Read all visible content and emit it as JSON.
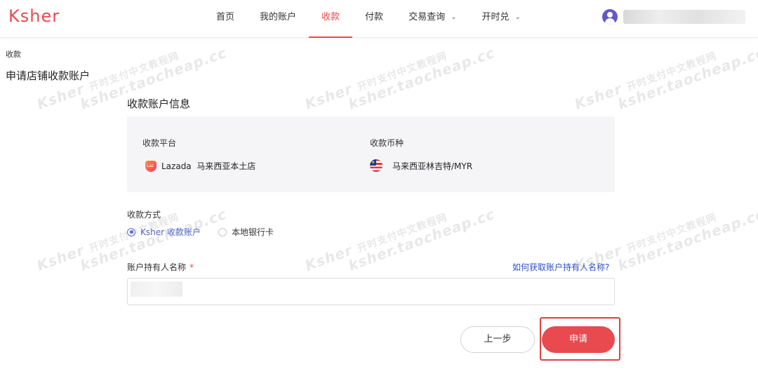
{
  "header": {
    "logo": "Ksher",
    "nav": [
      {
        "label": "首页",
        "active": false,
        "dropdown": false
      },
      {
        "label": "我的账户",
        "active": false,
        "dropdown": false
      },
      {
        "label": "收款",
        "active": true,
        "dropdown": false
      },
      {
        "label": "付款",
        "active": false,
        "dropdown": false
      },
      {
        "label": "交易查询",
        "active": false,
        "dropdown": true
      },
      {
        "label": "开时兑",
        "active": false,
        "dropdown": true
      }
    ],
    "avatar_icon": "user-icon"
  },
  "breadcrumb": "收款",
  "page_title": "申请店铺收款账户",
  "section_title": "收款账户信息",
  "account_info": {
    "platform_label": "收款平台",
    "platform_icon": "lazada-icon",
    "platform_value": "Lazada  马来西亚本土店",
    "currency_label": "收款币种",
    "currency_icon": "malaysia-flag-icon",
    "currency_value": "马来西亚林吉特/MYR"
  },
  "payment_method": {
    "label": "收款方式",
    "options": [
      {
        "label": "Ksher 收款账户",
        "checked": true
      },
      {
        "label": "本地银行卡",
        "checked": false
      }
    ]
  },
  "holder": {
    "label": "账户持有人名称",
    "required_mark": "*",
    "help_link": "如何获取账户持有人名称?"
  },
  "buttons": {
    "prev": "上一步",
    "apply": "申请"
  },
  "watermark": {
    "brand": "Ksher",
    "cn_text": "开时支付中文教程网",
    "site": "ksher.taocheap.cc"
  },
  "colors": {
    "brand_red": "#e84a4f",
    "link_blue": "#2d4ec5",
    "radio_blue": "#5b6bd6",
    "info_box_bg": "#f5f5f7"
  }
}
